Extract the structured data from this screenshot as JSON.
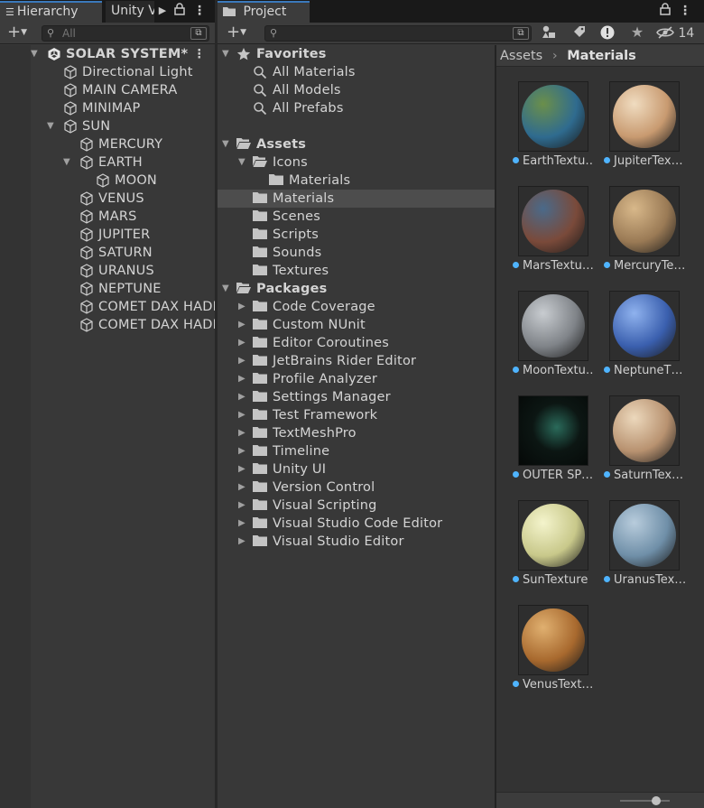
{
  "hierarchy": {
    "tab_label": "Hierarchy",
    "tab2_label": "Unity V",
    "search_placeholder": "All",
    "items": [
      {
        "label": "SOLAR SYSTEM*",
        "depth": 0,
        "expanded": true,
        "icon": "unity-scene-icon",
        "bold": true
      },
      {
        "label": "Directional Light",
        "depth": 1,
        "icon": "gameobject-cube-icon"
      },
      {
        "label": "MAIN CAMERA",
        "depth": 1,
        "icon": "gameobject-cube-icon"
      },
      {
        "label": "MINIMAP",
        "depth": 1,
        "icon": "gameobject-cube-icon"
      },
      {
        "label": "SUN",
        "depth": 1,
        "expanded": true,
        "icon": "gameobject-cube-icon"
      },
      {
        "label": "MERCURY",
        "depth": 2,
        "icon": "gameobject-cube-icon"
      },
      {
        "label": "EARTH",
        "depth": 2,
        "expanded": true,
        "icon": "gameobject-cube-icon"
      },
      {
        "label": "MOON",
        "depth": 3,
        "icon": "gameobject-cube-icon"
      },
      {
        "label": "VENUS",
        "depth": 2,
        "icon": "gameobject-cube-icon"
      },
      {
        "label": "MARS",
        "depth": 2,
        "icon": "gameobject-cube-icon"
      },
      {
        "label": "JUPITER",
        "depth": 2,
        "icon": "gameobject-cube-icon"
      },
      {
        "label": "SATURN",
        "depth": 2,
        "icon": "gameobject-cube-icon"
      },
      {
        "label": "URANUS",
        "depth": 2,
        "icon": "gameobject-cube-icon"
      },
      {
        "label": "NEPTUNE",
        "depth": 2,
        "icon": "gameobject-cube-icon"
      },
      {
        "label": "COMET DAX HADI",
        "depth": 2,
        "icon": "gameobject-cube-icon"
      },
      {
        "label": "COMET DAX HADI",
        "depth": 2,
        "icon": "gameobject-cube-icon"
      }
    ]
  },
  "project": {
    "tab_label": "Project",
    "hidden_count": "14",
    "tree": [
      {
        "label": "Favorites",
        "depth": 0,
        "expanded": true,
        "icon": "star-icon",
        "bold": true
      },
      {
        "label": "All Materials",
        "depth": 1,
        "icon": "search-icon"
      },
      {
        "label": "All Models",
        "depth": 1,
        "icon": "search-icon"
      },
      {
        "label": "All Prefabs",
        "depth": 1,
        "icon": "search-icon"
      },
      {
        "label": "",
        "depth": 0,
        "spacer": true
      },
      {
        "label": "Assets",
        "depth": 0,
        "expanded": true,
        "icon": "folder-open-icon",
        "bold": true
      },
      {
        "label": "Icons",
        "depth": 1,
        "expanded": true,
        "icon": "folder-open-icon"
      },
      {
        "label": "Materials",
        "depth": 2,
        "icon": "folder-icon"
      },
      {
        "label": "Materials",
        "depth": 1,
        "icon": "folder-icon",
        "selected": true
      },
      {
        "label": "Scenes",
        "depth": 1,
        "icon": "folder-icon"
      },
      {
        "label": "Scripts",
        "depth": 1,
        "icon": "folder-icon"
      },
      {
        "label": "Sounds",
        "depth": 1,
        "icon": "folder-icon"
      },
      {
        "label": "Textures",
        "depth": 1,
        "icon": "folder-icon"
      },
      {
        "label": "Packages",
        "depth": 0,
        "expanded": true,
        "icon": "folder-open-icon",
        "bold": true
      },
      {
        "label": "Code Coverage",
        "depth": 1,
        "collapsed": true,
        "icon": "folder-icon"
      },
      {
        "label": "Custom NUnit",
        "depth": 1,
        "collapsed": true,
        "icon": "folder-icon"
      },
      {
        "label": "Editor Coroutines",
        "depth": 1,
        "collapsed": true,
        "icon": "folder-icon"
      },
      {
        "label": "JetBrains Rider Editor",
        "depth": 1,
        "collapsed": true,
        "icon": "folder-icon"
      },
      {
        "label": "Profile Analyzer",
        "depth": 1,
        "collapsed": true,
        "icon": "folder-icon"
      },
      {
        "label": "Settings Manager",
        "depth": 1,
        "collapsed": true,
        "icon": "folder-icon"
      },
      {
        "label": "Test Framework",
        "depth": 1,
        "collapsed": true,
        "icon": "folder-icon"
      },
      {
        "label": "TextMeshPro",
        "depth": 1,
        "collapsed": true,
        "icon": "folder-icon"
      },
      {
        "label": "Timeline",
        "depth": 1,
        "collapsed": true,
        "icon": "folder-icon"
      },
      {
        "label": "Unity UI",
        "depth": 1,
        "collapsed": true,
        "icon": "folder-icon"
      },
      {
        "label": "Version Control",
        "depth": 1,
        "collapsed": true,
        "icon": "folder-icon"
      },
      {
        "label": "Visual Scripting",
        "depth": 1,
        "collapsed": true,
        "icon": "folder-icon"
      },
      {
        "label": "Visual Studio Code Editor",
        "depth": 1,
        "collapsed": true,
        "icon": "folder-icon"
      },
      {
        "label": "Visual Studio Editor",
        "depth": 1,
        "collapsed": true,
        "icon": "folder-icon"
      }
    ],
    "breadcrumb": {
      "root": "Assets",
      "current": "Materials"
    },
    "assets": [
      {
        "label": "EarthTextu…",
        "color": "#2f6b8f",
        "accent": "#6b8f4a"
      },
      {
        "label": "JupiterTex…",
        "color": "#c89a70",
        "accent": "#f0dcc0"
      },
      {
        "label": "MarsTextu…",
        "color": "#7a4a3a",
        "accent": "#4a6a8a"
      },
      {
        "label": "MercuryTe…",
        "color": "#9a7a55",
        "accent": "#d8b88a"
      },
      {
        "label": "MoonTextu…",
        "color": "#7f8388",
        "accent": "#c8ccd0"
      },
      {
        "label": "NeptuneT…",
        "color": "#3a5fae",
        "accent": "#8fb2ee"
      },
      {
        "label": "OUTER SP…",
        "color": "#0c1613",
        "accent": "#2a6a5a",
        "square": true
      },
      {
        "label": "SaturnTex…",
        "color": "#b89270",
        "accent": "#ecd8bc"
      },
      {
        "label": "SunTexture",
        "color": "#c8c88a",
        "accent": "#f4f4cc"
      },
      {
        "label": "UranusTex…",
        "color": "#6f8fa8",
        "accent": "#b8ccdc"
      },
      {
        "label": "VenusText…",
        "color": "#a8692e",
        "accent": "#e0b070"
      }
    ]
  },
  "colors": {
    "accent": "#3a79bb",
    "selection": "#4d4d4d",
    "dot": "#4fb4ff"
  }
}
